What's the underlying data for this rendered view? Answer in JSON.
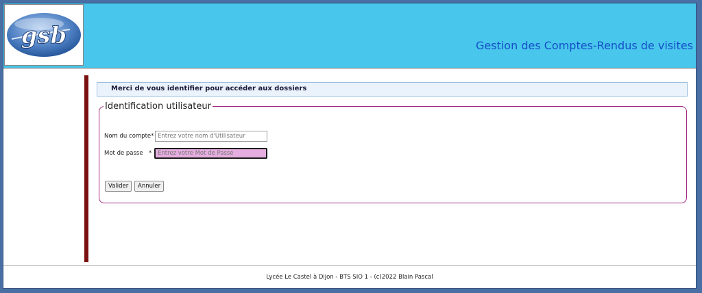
{
  "header": {
    "logo_text": "gsb",
    "title": "Gestion des Comptes-Rendus de visites"
  },
  "notice": "Merci de vous identifier pour accéder aux dossiers",
  "form": {
    "legend": "Identification utilisateur",
    "username_label": "Nom du compte*",
    "username_placeholder": "Entrez votre nom d'Utilisateur",
    "password_label": "Mot de passe",
    "password_required": "*",
    "password_placeholder": "Entrez votre Mot de Passe",
    "submit_label": "Valider",
    "cancel_label": "Annuler"
  },
  "footer": "Lycée Le Castel à Dijon - BTS SIO 1 - (c)2022 Blain Pascal",
  "colors": {
    "header_bg": "#48c6ec",
    "title": "#1550c8",
    "accent_bar": "#7b1010",
    "fieldset_border": "#a0287e",
    "password_focus_bg": "#e6aee0"
  }
}
